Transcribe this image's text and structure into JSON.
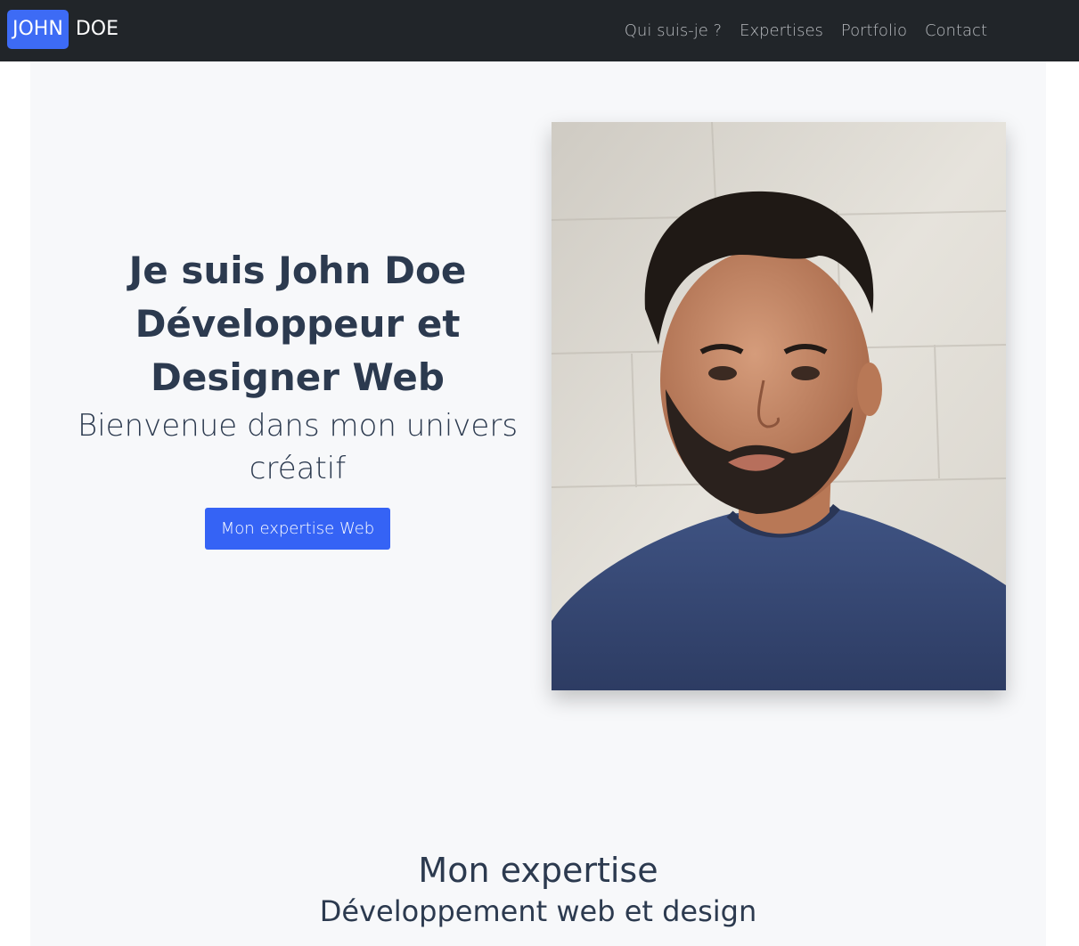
{
  "nav": {
    "brand_first": "JOHN",
    "brand_last": "DOE",
    "links": [
      "Qui suis-je ?",
      "Expertises",
      "Portfolio",
      "Contact"
    ]
  },
  "hero": {
    "title_lines": [
      "Je suis John Doe",
      "Développeur et",
      "Designer Web"
    ],
    "subtitle": "Bienvenue dans mon univers créatif",
    "cta_label": "Mon expertise Web"
  },
  "expertise": {
    "title": "Mon expertise",
    "subtitle": "Développement web et design"
  },
  "colors": {
    "navbar": "#212529",
    "brand_accent": "#3d6bf5",
    "button": "#3563f5",
    "heading": "#2c3a4f",
    "page_bg": "#f7f8fa"
  }
}
